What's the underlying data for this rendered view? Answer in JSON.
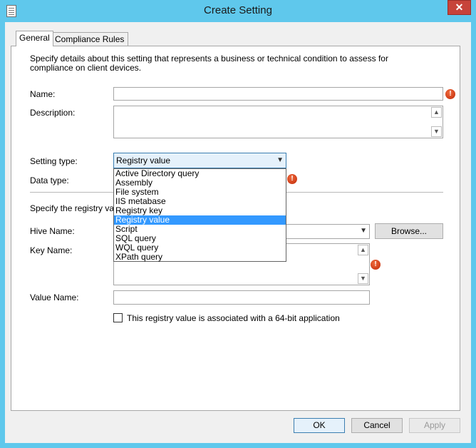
{
  "window": {
    "title": "Create Setting",
    "close_glyph": "✕",
    "icon": "document-icon"
  },
  "tabs": [
    {
      "label": "General",
      "active": true
    },
    {
      "label": "Compliance Rules",
      "active": false
    }
  ],
  "general": {
    "intro": "Specify details about this setting that represents a business or technical condition to assess for compliance on client devices.",
    "name_label": "Name:",
    "name_value": "",
    "description_label": "Description:",
    "description_value": "",
    "setting_type_label": "Setting type:",
    "setting_type_value": "Registry value",
    "data_type_label": "Data type:",
    "registry_section_label": "Specify the registry value",
    "hive_name_label": "Hive Name:",
    "hive_name_value": "",
    "browse_label": "Browse...",
    "key_name_label": "Key Name:",
    "key_name_value": "",
    "value_name_label": "Value Name:",
    "value_name_value": "",
    "checkbox_label": "This registry value is associated with a 64-bit application",
    "checkbox_checked": false
  },
  "setting_type_options": [
    "Active Directory query",
    "Assembly",
    "File system",
    "IIS metabase",
    "Registry key",
    "Registry value",
    "Script",
    "SQL query",
    "WQL query",
    "XPath query"
  ],
  "setting_type_selected": "Registry value",
  "buttons": {
    "ok": "OK",
    "cancel": "Cancel",
    "apply": "Apply"
  },
  "glyphs": {
    "error": "!",
    "scroll_up": "▲",
    "scroll_down": "▼",
    "combo_arrow": "▼"
  },
  "colors": {
    "title_bar": "#5fc8ec",
    "close_button": "#c7443a",
    "selection": "#3399ff",
    "error_icon": "#d23b12"
  }
}
